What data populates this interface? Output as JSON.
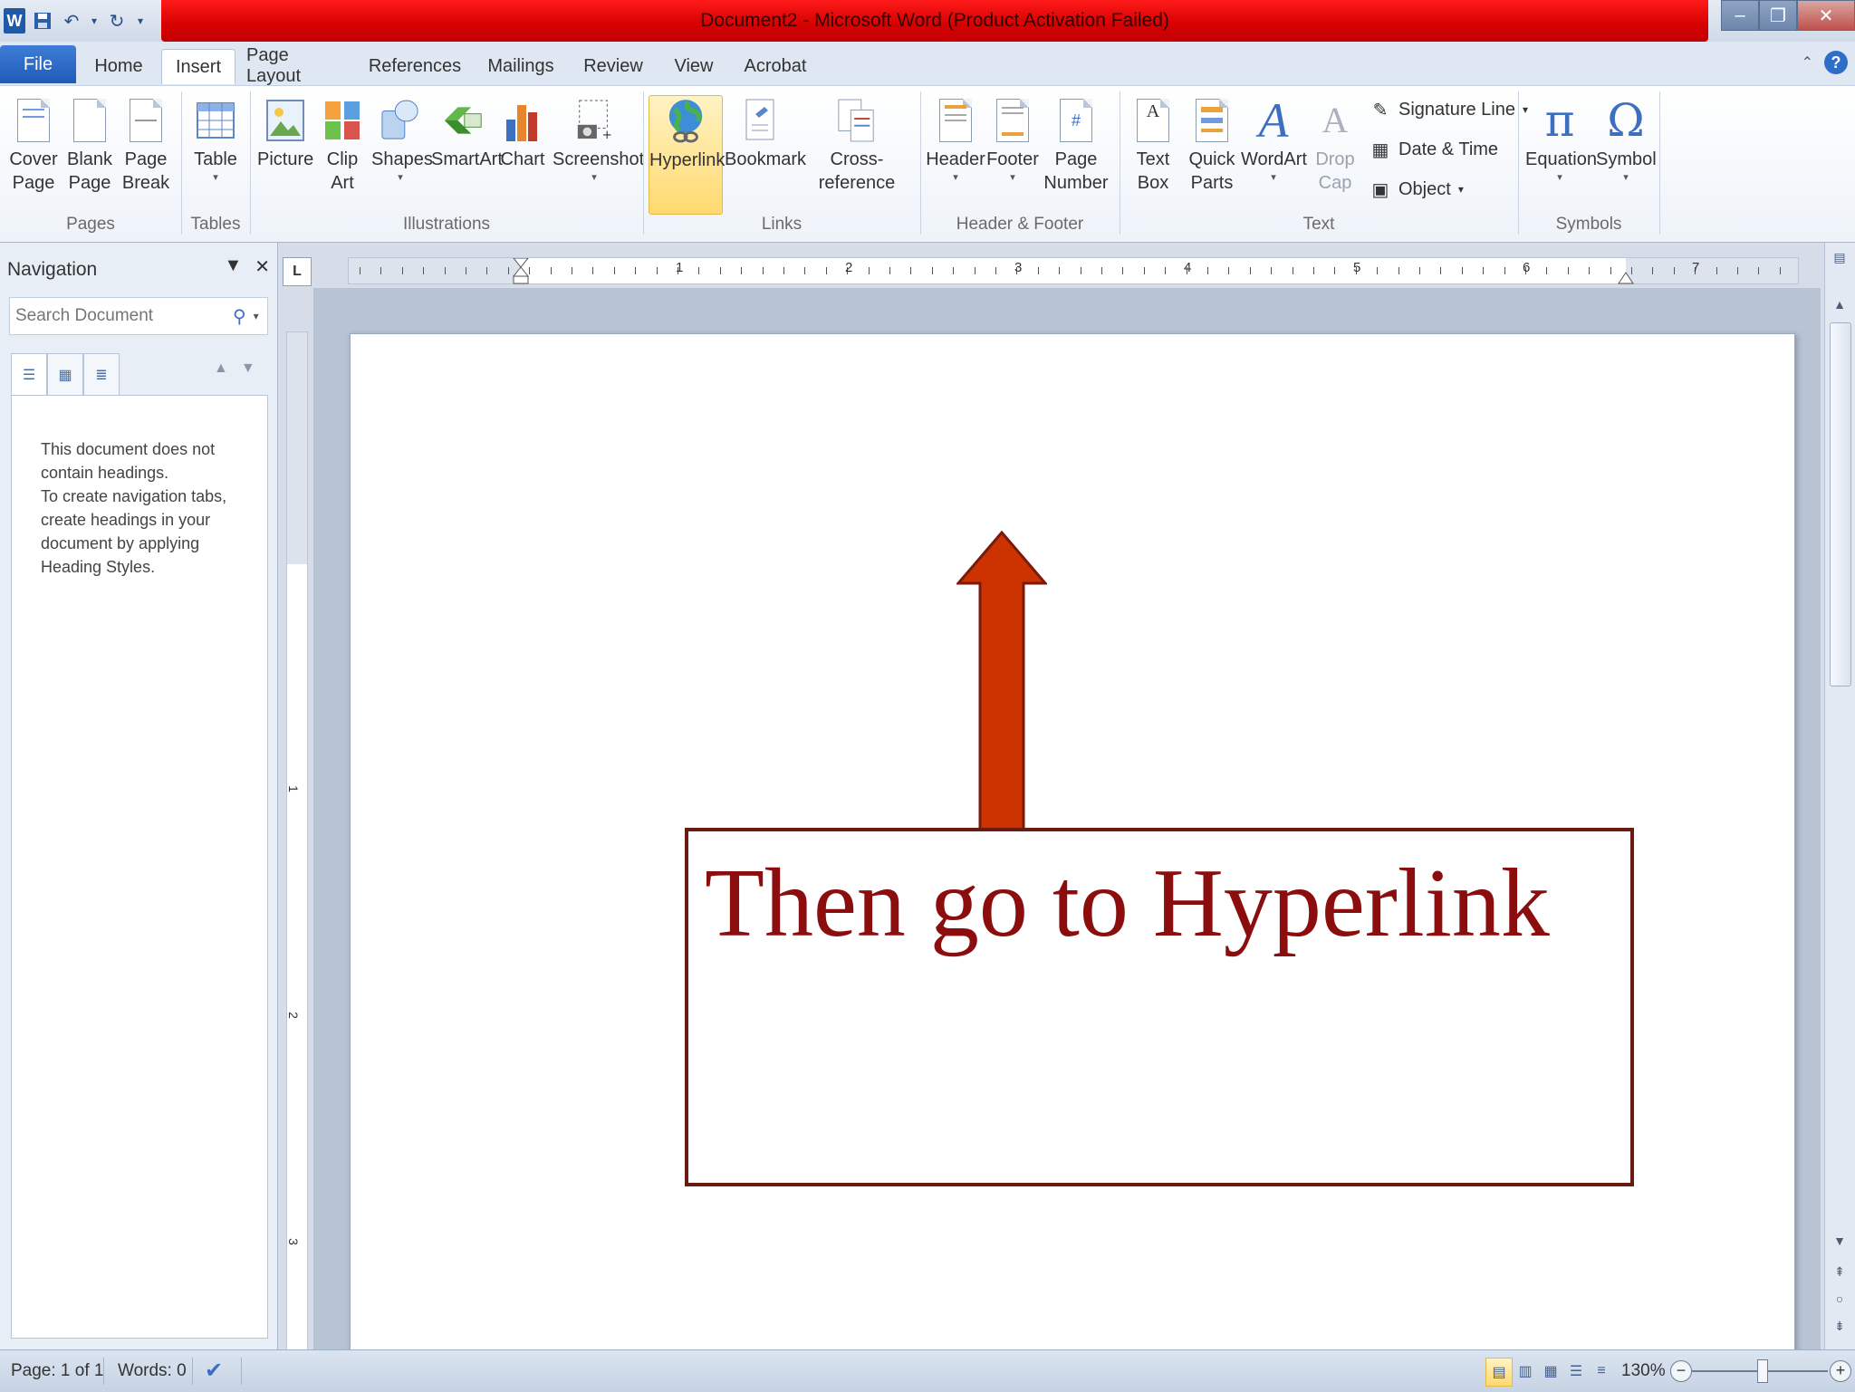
{
  "title_bar": {
    "title": "Document2 - Microsoft Word (Product Activation Failed)",
    "app_icon": "W",
    "window_controls": [
      "minimize",
      "restore",
      "close"
    ]
  },
  "tabs": [
    "File",
    "Home",
    "Insert",
    "Page Layout",
    "References",
    "Mailings",
    "Review",
    "View",
    "Acrobat"
  ],
  "active_tab": "Insert",
  "ribbon": {
    "pages": {
      "cover_page": "Cover\nPage",
      "blank_page": "Blank\nPage",
      "page_break": "Page\nBreak",
      "group": "Pages"
    },
    "tables": {
      "table": "Table",
      "group": "Tables"
    },
    "illustrations": {
      "picture": "Picture",
      "clip_art": "Clip\nArt",
      "shapes": "Shapes",
      "smartart": "SmartArt",
      "chart": "Chart",
      "screenshot": "Screenshot",
      "group": "Illustrations"
    },
    "links": {
      "hyperlink": "Hyperlink",
      "bookmark": "Bookmark",
      "cross_reference": "Cross-reference",
      "group": "Links"
    },
    "header_footer": {
      "header": "Header",
      "footer": "Footer",
      "page_number": "Page\nNumber",
      "group": "Header & Footer"
    },
    "text": {
      "text_box": "Text\nBox",
      "quick_parts": "Quick\nParts",
      "wordart": "WordArt",
      "drop_cap": "Drop\nCap",
      "signature_line": "Signature Line",
      "date_time": "Date & Time",
      "object": "Object",
      "group": "Text"
    },
    "symbols": {
      "equation": "Equation",
      "symbol": "Symbol",
      "group": "Symbols"
    }
  },
  "navigation": {
    "title": "Navigation",
    "search_placeholder": "Search Document",
    "message_1": "This document does not contain headings.",
    "message_2": "To create navigation tabs, create headings in your document by applying Heading Styles."
  },
  "ruler": {
    "h_numbers": [
      "1",
      "2",
      "3",
      "4",
      "5",
      "6",
      "7"
    ],
    "v_numbers": [
      "1",
      "2",
      "3"
    ],
    "corner": "L"
  },
  "document": {
    "callout_text": "Then go to Hyperlink",
    "callout_color": "#8b0d0d",
    "arrow_color": "#cc3300"
  },
  "status_bar": {
    "page": "Page: 1 of 1",
    "words": "Words: 0",
    "zoom": "130%"
  },
  "colors": {
    "title_bar_alert": "#e00000",
    "file_tab": "#2a63c2",
    "hyperlink_highlight": "#ffd970"
  }
}
